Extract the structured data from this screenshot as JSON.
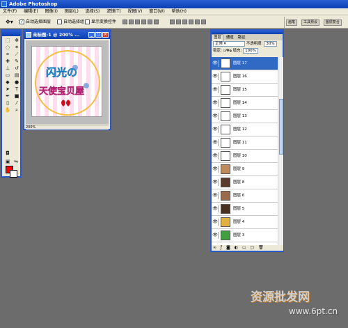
{
  "app": {
    "title": "Adobe Photoshop"
  },
  "menu": [
    "文件(F)",
    "编辑(E)",
    "图像(I)",
    "图层(L)",
    "选择(S)",
    "滤镜(T)",
    "视图(V)",
    "窗口(W)",
    "帮助(H)"
  ],
  "options": {
    "auto_select_layer": "自动选择图层",
    "auto_select_group": "自动选择组",
    "show_transform": "显示变换控件"
  },
  "palette_well": [
    "画笔",
    "工具预设",
    "图层复合"
  ],
  "document": {
    "title": "未标题-1 @ 200% ...",
    "zoom": "200%"
  },
  "artwork": {
    "line1": "闪光の",
    "line2": "天使宝贝屋"
  },
  "layers_panel": {
    "tabs": [
      "图层",
      "通道",
      "路径"
    ],
    "blend_mode": "正常",
    "opacity_label": "不透明度:",
    "opacity_value": "30%",
    "lock_label": "锁定:",
    "fill_label": "填充:",
    "fill_value": "100%",
    "layers": [
      "图层 17",
      "图层 16",
      "图层 15",
      "图层 14",
      "图层 13",
      "图层 12",
      "图层 11",
      "图层 10",
      "图层 9",
      "图层 8",
      "图层 6",
      "图层 5",
      "图层 4",
      "图层 3"
    ]
  },
  "watermark": {
    "text": "资源批发网",
    "url": "www.6pt.cn"
  },
  "colors": {
    "foreground": "#ff0000",
    "background": "#ffffff",
    "accent": "#316ac5"
  }
}
